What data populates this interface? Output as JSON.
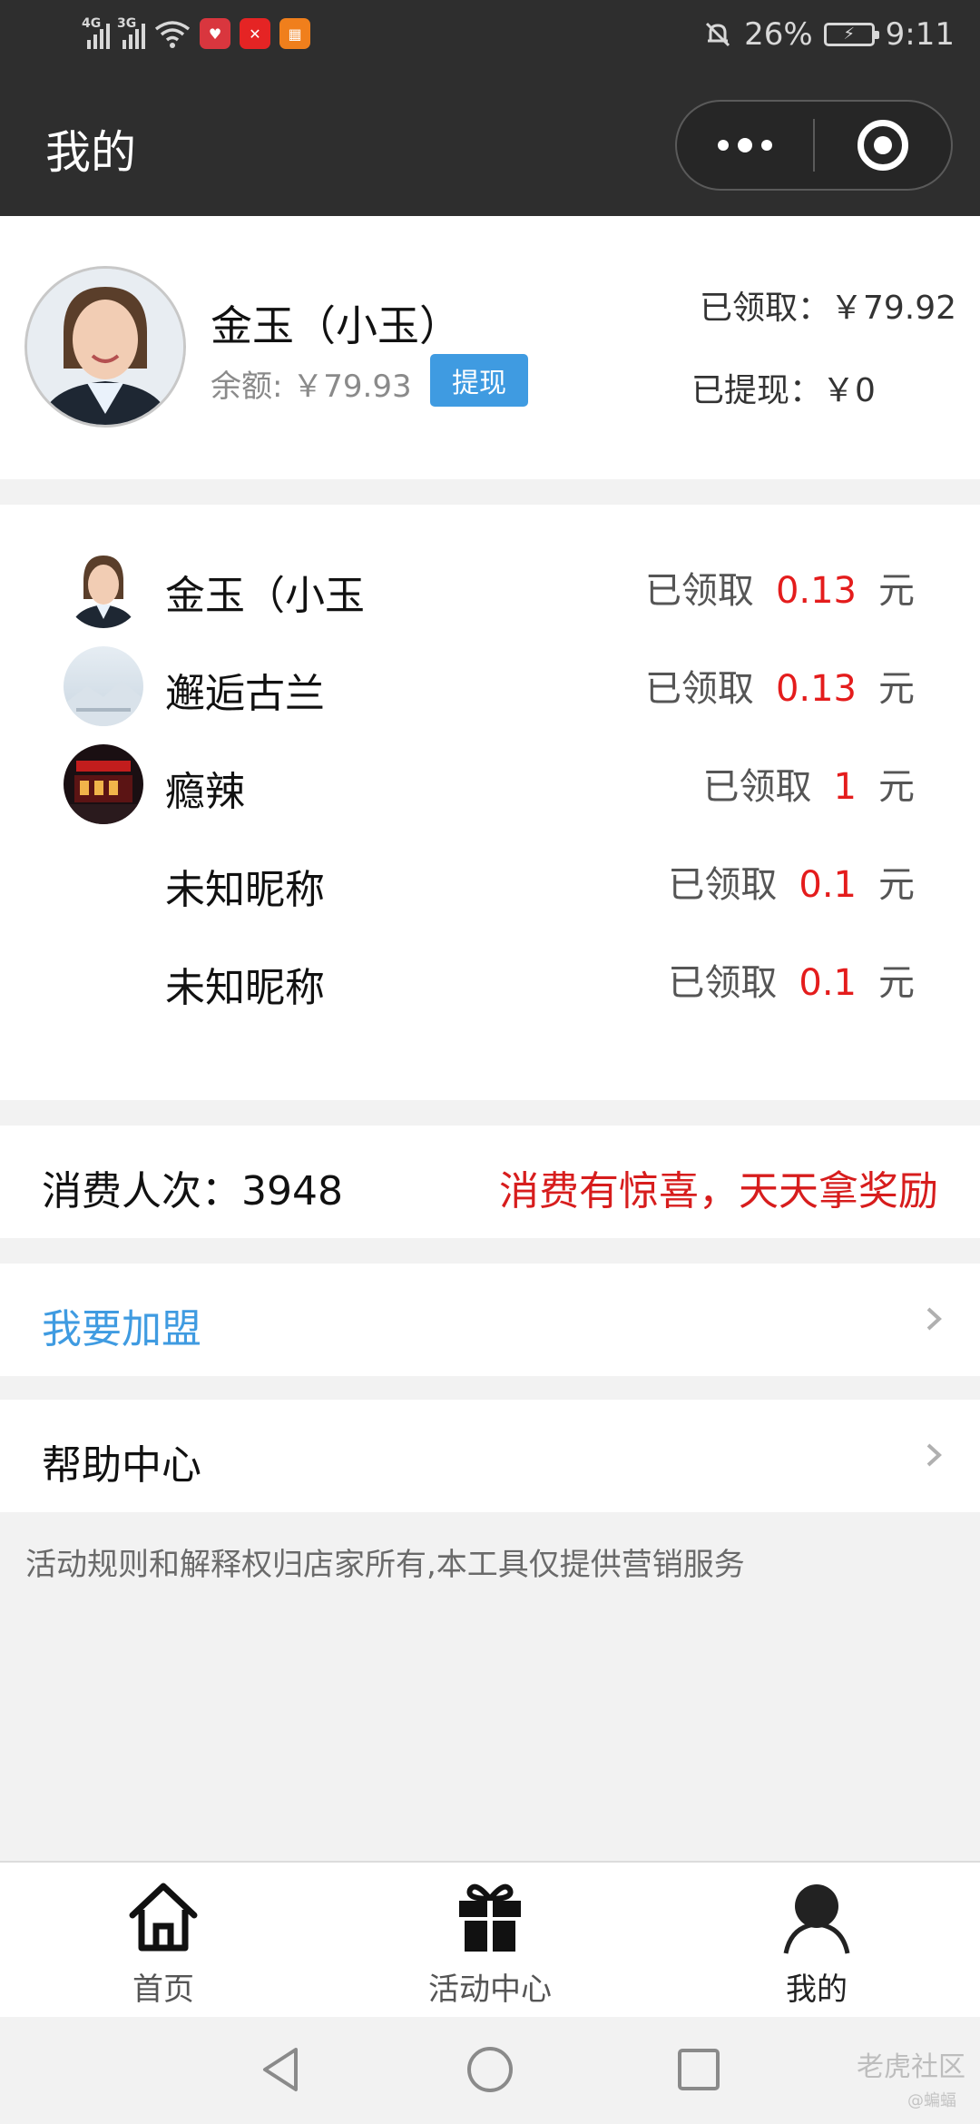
{
  "status_bar": {
    "net1": "4G",
    "net2": "3G",
    "battery": "26%",
    "time": "9:11",
    "badge_colors": [
      "#d9363e",
      "#e52424",
      "#f07f1c"
    ]
  },
  "nav": {
    "title": "我的"
  },
  "profile": {
    "name": "金玉（小玉）",
    "balance": "余额: ￥79.93",
    "withdraw_button": "提现",
    "received": "已领取：￥79.92",
    "withdrawn": "已提现：￥0"
  },
  "records": [
    {
      "name": "金玉（小玉",
      "status": "已领取",
      "amount": "0.13",
      "unit": "元",
      "avatar": "photo"
    },
    {
      "name": "邂逅古兰",
      "status": "已领取",
      "amount": "0.13",
      "unit": "元",
      "avatar": "landscape"
    },
    {
      "name": "瘾辣",
      "status": "已领取",
      "amount": "1",
      "unit": "元",
      "avatar": "shop"
    },
    {
      "name": "未知昵称",
      "status": "已领取",
      "amount": "0.1",
      "unit": "元",
      "avatar": "none"
    },
    {
      "name": "未知昵称",
      "status": "已领取",
      "amount": "0.1",
      "unit": "元",
      "avatar": "none"
    }
  ],
  "stats": {
    "count": "消费人次：3948",
    "slogan": "消费有惊喜，天天拿奖励"
  },
  "menu": {
    "join": "我要加盟",
    "help": "帮助中心"
  },
  "notice": "活动规则和解释权归店家所有,本工具仅提供营销服务",
  "tabs": [
    {
      "label": "首页",
      "icon": "home-icon"
    },
    {
      "label": "活动中心",
      "icon": "gift-icon"
    },
    {
      "label": "我的",
      "icon": "user-icon"
    }
  ],
  "watermark": {
    "text": "老虎社区",
    "sub": "@蝙蝠"
  },
  "colors": {
    "header_bg": "#2e2e2e",
    "accent_blue": "#3f9be1",
    "amount_red": "#e41c1c",
    "page_bg": "#f2f2f2"
  }
}
